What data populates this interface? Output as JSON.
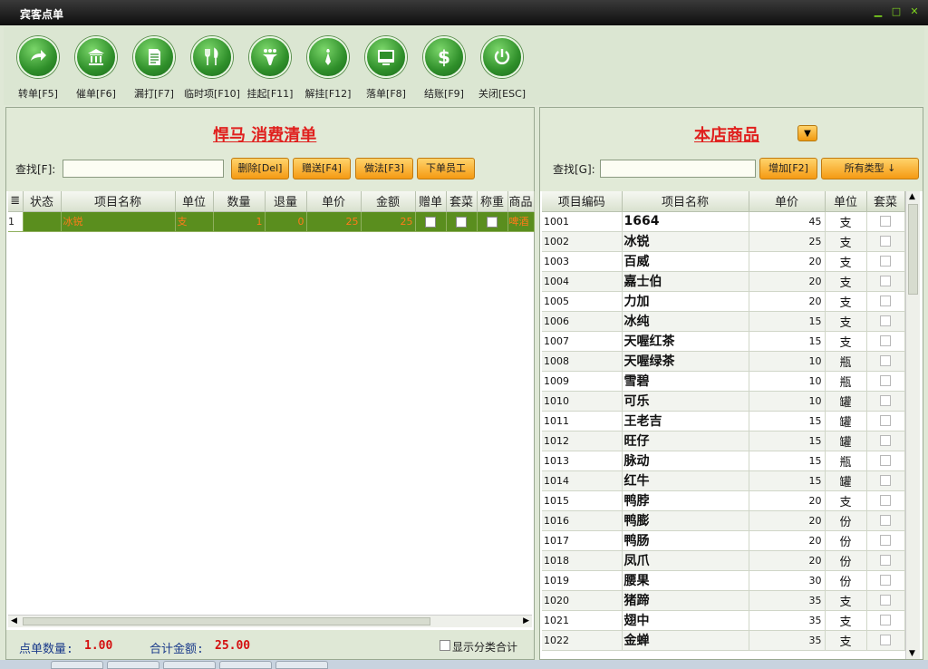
{
  "window": {
    "title": "宾客点单"
  },
  "toolbar": [
    {
      "label": "转单[F5]",
      "icon": "transfer-icon"
    },
    {
      "label": "催单[F6]",
      "icon": "bank-icon"
    },
    {
      "label": "漏打[F7]",
      "icon": "document-icon"
    },
    {
      "label": "临时项[F10]",
      "icon": "utensils-icon"
    },
    {
      "label": "挂起[F11]",
      "icon": "hanger-icon"
    },
    {
      "label": "解挂[F12]",
      "icon": "tie-icon"
    },
    {
      "label": "落单[F8]",
      "icon": "screen-icon"
    },
    {
      "label": "结账[F9]",
      "icon": "dollar-icon"
    },
    {
      "label": "关闭[ESC]",
      "icon": "power-icon"
    }
  ],
  "order": {
    "title": "悍马  消费清单",
    "search_label": "查找[F]:",
    "search_value": "",
    "buttons": [
      "删除[Del]",
      "赠送[F4]",
      "做法[F3]",
      "下单员工"
    ],
    "columns": [
      "≣",
      "状态",
      "项目名称",
      "单位",
      "数量",
      "退量",
      "单价",
      "金额",
      "赠单",
      "套菜",
      "称重",
      "商品"
    ],
    "rows": [
      {
        "idx": "1",
        "status": "",
        "name": "冰锐",
        "unit": "支",
        "qty": "1",
        "ret": "0",
        "price": "25",
        "amount": "25",
        "gift": false,
        "set": false,
        "weigh": false,
        "goods": "啤酒"
      }
    ],
    "footer": {
      "qty_label": "点单数量:",
      "qty_value": "1.00",
      "total_label": "合计金额:",
      "total_value": "25.00",
      "show_category_label": "显示分类合计",
      "show_category_checked": false
    }
  },
  "products": {
    "title": "本店商品",
    "search_label": "查找[G]:",
    "search_value": "",
    "add_button": "增加[F2]",
    "type_button": "所有类型 ↓",
    "columns": [
      "项目编码",
      "项目名称",
      "单价",
      "单位",
      "套菜"
    ],
    "rows": [
      {
        "code": "1001",
        "name": "1664",
        "price": "45",
        "unit": "支"
      },
      {
        "code": "1002",
        "name": "冰锐",
        "price": "25",
        "unit": "支"
      },
      {
        "code": "1003",
        "name": "百威",
        "price": "20",
        "unit": "支"
      },
      {
        "code": "1004",
        "name": "嘉士伯",
        "price": "20",
        "unit": "支"
      },
      {
        "code": "1005",
        "name": "力加",
        "price": "20",
        "unit": "支"
      },
      {
        "code": "1006",
        "name": "冰纯",
        "price": "15",
        "unit": "支"
      },
      {
        "code": "1007",
        "name": "天喔红茶",
        "price": "15",
        "unit": "支"
      },
      {
        "code": "1008",
        "name": "天喔绿茶",
        "price": "10",
        "unit": "瓶"
      },
      {
        "code": "1009",
        "name": "雪碧",
        "price": "10",
        "unit": "瓶"
      },
      {
        "code": "1010",
        "name": "可乐",
        "price": "10",
        "unit": "罐"
      },
      {
        "code": "1011",
        "name": "王老吉",
        "price": "15",
        "unit": "罐"
      },
      {
        "code": "1012",
        "name": "旺仔",
        "price": "15",
        "unit": "罐"
      },
      {
        "code": "1013",
        "name": "脉动",
        "price": "15",
        "unit": "瓶"
      },
      {
        "code": "1014",
        "name": "红牛",
        "price": "15",
        "unit": "罐"
      },
      {
        "code": "1015",
        "name": "鸭脖",
        "price": "20",
        "unit": "支"
      },
      {
        "code": "1016",
        "name": "鸭膨",
        "price": "20",
        "unit": "份"
      },
      {
        "code": "1017",
        "name": "鸭肠",
        "price": "20",
        "unit": "份"
      },
      {
        "code": "1018",
        "name": "凤爪",
        "price": "20",
        "unit": "份"
      },
      {
        "code": "1019",
        "name": "腰果",
        "price": "30",
        "unit": "份"
      },
      {
        "code": "1020",
        "name": "猪蹄",
        "price": "35",
        "unit": "支"
      },
      {
        "code": "1021",
        "name": "翅中",
        "price": "35",
        "unit": "支"
      },
      {
        "code": "1022",
        "name": "金蝉",
        "price": "35",
        "unit": "支"
      }
    ]
  },
  "colors": {
    "accent": "#e0201e",
    "button": "#f59a13",
    "selected_row": "#5a8e1e"
  }
}
